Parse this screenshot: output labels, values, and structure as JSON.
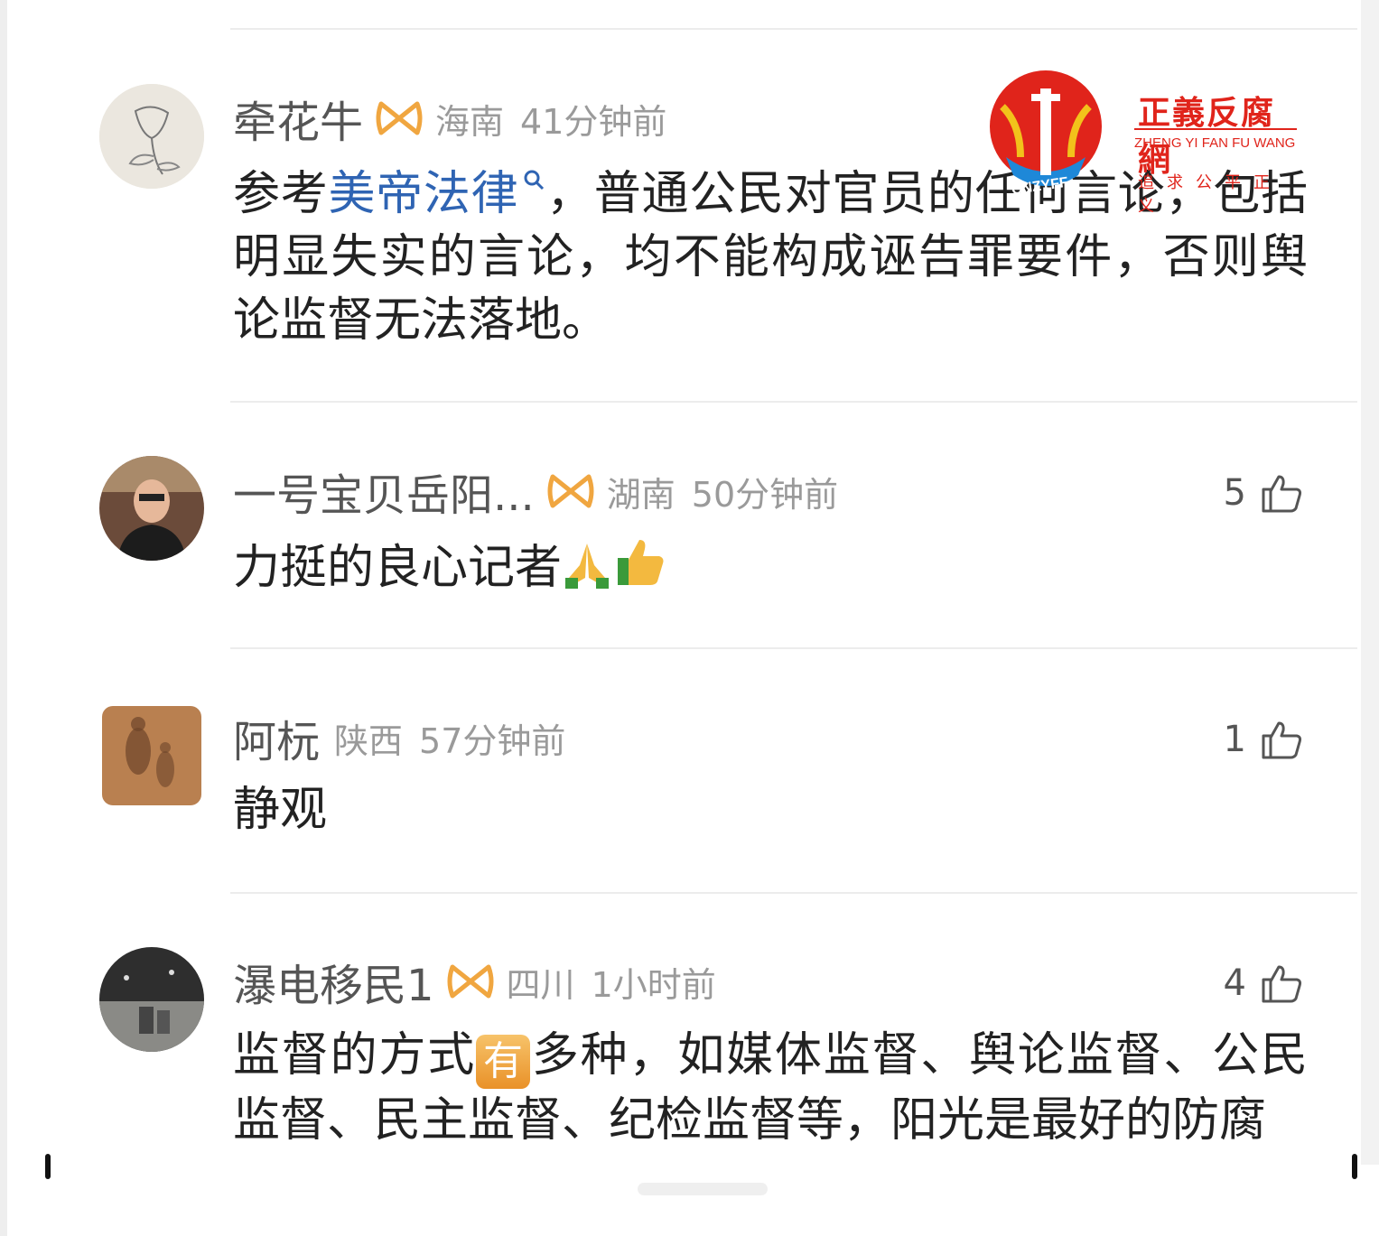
{
  "comments": [
    {
      "name": "牵花牛",
      "location": "海南",
      "time": "41分钟前",
      "likes": "",
      "text_before": "参考",
      "link": "美帝法律",
      "text_after": "，普通公民对官员的任何言论，包括明显失实的言论，均不能构成诬告罪要件，否则舆论监督无法落地。"
    },
    {
      "name": "一号宝贝岳阳...",
      "location": "湖南",
      "time": "50分钟前",
      "likes": "5",
      "text": "力挺的良心记者"
    },
    {
      "name": "阿杬",
      "location": "陕西",
      "time": "57分钟前",
      "likes": "1",
      "text": "静观"
    },
    {
      "name": "瀑电移民1",
      "location": "四川",
      "time": "1小时前",
      "likes": "4",
      "text_before": "监督的方式",
      "badge": "有",
      "text_after": "多种，如媒体监督、舆论监督、公民监督、民主监督、纪检监督等，阳光是最好的防腐"
    }
  ],
  "watermark": {
    "title": "正義反腐網",
    "subtitle": "ZHENG YI FAN FU WANG",
    "slogan": "追求公平正义",
    "badge": "CNZYFF"
  },
  "colors": {
    "link": "#2f64b3",
    "meta": "#9a9a9a",
    "vip": "#f0a640",
    "watermark": "#e0241b"
  }
}
